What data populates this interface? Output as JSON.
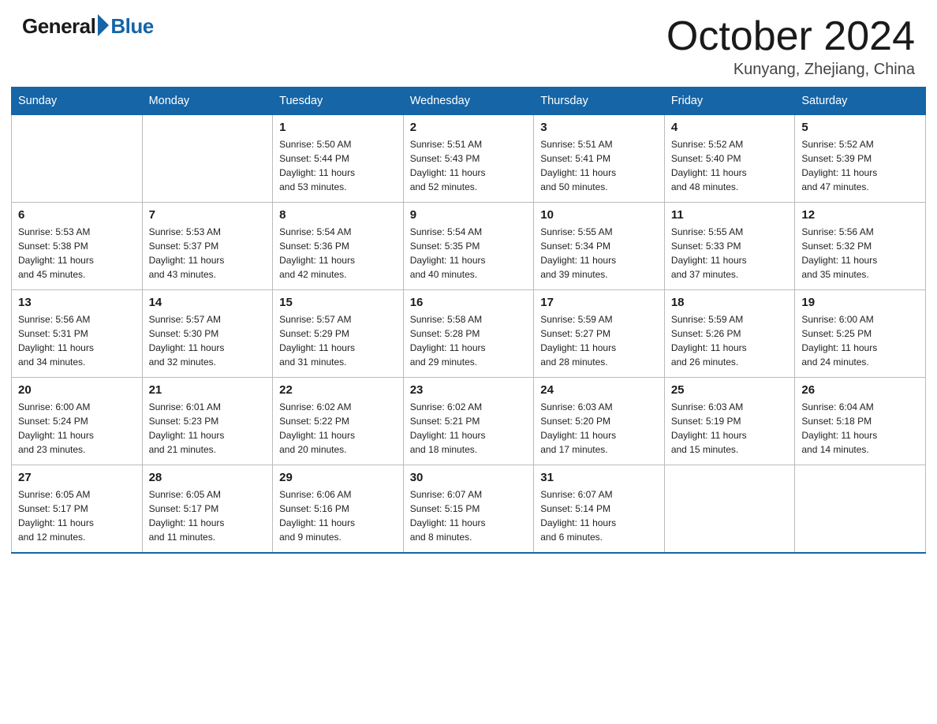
{
  "header": {
    "logo_general": "General",
    "logo_blue": "Blue",
    "title": "October 2024",
    "location": "Kunyang, Zhejiang, China"
  },
  "days_of_week": [
    "Sunday",
    "Monday",
    "Tuesday",
    "Wednesday",
    "Thursday",
    "Friday",
    "Saturday"
  ],
  "weeks": [
    [
      {
        "day": "",
        "info": ""
      },
      {
        "day": "",
        "info": ""
      },
      {
        "day": "1",
        "info": "Sunrise: 5:50 AM\nSunset: 5:44 PM\nDaylight: 11 hours\nand 53 minutes."
      },
      {
        "day": "2",
        "info": "Sunrise: 5:51 AM\nSunset: 5:43 PM\nDaylight: 11 hours\nand 52 minutes."
      },
      {
        "day": "3",
        "info": "Sunrise: 5:51 AM\nSunset: 5:41 PM\nDaylight: 11 hours\nand 50 minutes."
      },
      {
        "day": "4",
        "info": "Sunrise: 5:52 AM\nSunset: 5:40 PM\nDaylight: 11 hours\nand 48 minutes."
      },
      {
        "day": "5",
        "info": "Sunrise: 5:52 AM\nSunset: 5:39 PM\nDaylight: 11 hours\nand 47 minutes."
      }
    ],
    [
      {
        "day": "6",
        "info": "Sunrise: 5:53 AM\nSunset: 5:38 PM\nDaylight: 11 hours\nand 45 minutes."
      },
      {
        "day": "7",
        "info": "Sunrise: 5:53 AM\nSunset: 5:37 PM\nDaylight: 11 hours\nand 43 minutes."
      },
      {
        "day": "8",
        "info": "Sunrise: 5:54 AM\nSunset: 5:36 PM\nDaylight: 11 hours\nand 42 minutes."
      },
      {
        "day": "9",
        "info": "Sunrise: 5:54 AM\nSunset: 5:35 PM\nDaylight: 11 hours\nand 40 minutes."
      },
      {
        "day": "10",
        "info": "Sunrise: 5:55 AM\nSunset: 5:34 PM\nDaylight: 11 hours\nand 39 minutes."
      },
      {
        "day": "11",
        "info": "Sunrise: 5:55 AM\nSunset: 5:33 PM\nDaylight: 11 hours\nand 37 minutes."
      },
      {
        "day": "12",
        "info": "Sunrise: 5:56 AM\nSunset: 5:32 PM\nDaylight: 11 hours\nand 35 minutes."
      }
    ],
    [
      {
        "day": "13",
        "info": "Sunrise: 5:56 AM\nSunset: 5:31 PM\nDaylight: 11 hours\nand 34 minutes."
      },
      {
        "day": "14",
        "info": "Sunrise: 5:57 AM\nSunset: 5:30 PM\nDaylight: 11 hours\nand 32 minutes."
      },
      {
        "day": "15",
        "info": "Sunrise: 5:57 AM\nSunset: 5:29 PM\nDaylight: 11 hours\nand 31 minutes."
      },
      {
        "day": "16",
        "info": "Sunrise: 5:58 AM\nSunset: 5:28 PM\nDaylight: 11 hours\nand 29 minutes."
      },
      {
        "day": "17",
        "info": "Sunrise: 5:59 AM\nSunset: 5:27 PM\nDaylight: 11 hours\nand 28 minutes."
      },
      {
        "day": "18",
        "info": "Sunrise: 5:59 AM\nSunset: 5:26 PM\nDaylight: 11 hours\nand 26 minutes."
      },
      {
        "day": "19",
        "info": "Sunrise: 6:00 AM\nSunset: 5:25 PM\nDaylight: 11 hours\nand 24 minutes."
      }
    ],
    [
      {
        "day": "20",
        "info": "Sunrise: 6:00 AM\nSunset: 5:24 PM\nDaylight: 11 hours\nand 23 minutes."
      },
      {
        "day": "21",
        "info": "Sunrise: 6:01 AM\nSunset: 5:23 PM\nDaylight: 11 hours\nand 21 minutes."
      },
      {
        "day": "22",
        "info": "Sunrise: 6:02 AM\nSunset: 5:22 PM\nDaylight: 11 hours\nand 20 minutes."
      },
      {
        "day": "23",
        "info": "Sunrise: 6:02 AM\nSunset: 5:21 PM\nDaylight: 11 hours\nand 18 minutes."
      },
      {
        "day": "24",
        "info": "Sunrise: 6:03 AM\nSunset: 5:20 PM\nDaylight: 11 hours\nand 17 minutes."
      },
      {
        "day": "25",
        "info": "Sunrise: 6:03 AM\nSunset: 5:19 PM\nDaylight: 11 hours\nand 15 minutes."
      },
      {
        "day": "26",
        "info": "Sunrise: 6:04 AM\nSunset: 5:18 PM\nDaylight: 11 hours\nand 14 minutes."
      }
    ],
    [
      {
        "day": "27",
        "info": "Sunrise: 6:05 AM\nSunset: 5:17 PM\nDaylight: 11 hours\nand 12 minutes."
      },
      {
        "day": "28",
        "info": "Sunrise: 6:05 AM\nSunset: 5:17 PM\nDaylight: 11 hours\nand 11 minutes."
      },
      {
        "day": "29",
        "info": "Sunrise: 6:06 AM\nSunset: 5:16 PM\nDaylight: 11 hours\nand 9 minutes."
      },
      {
        "day": "30",
        "info": "Sunrise: 6:07 AM\nSunset: 5:15 PM\nDaylight: 11 hours\nand 8 minutes."
      },
      {
        "day": "31",
        "info": "Sunrise: 6:07 AM\nSunset: 5:14 PM\nDaylight: 11 hours\nand 6 minutes."
      },
      {
        "day": "",
        "info": ""
      },
      {
        "day": "",
        "info": ""
      }
    ]
  ]
}
